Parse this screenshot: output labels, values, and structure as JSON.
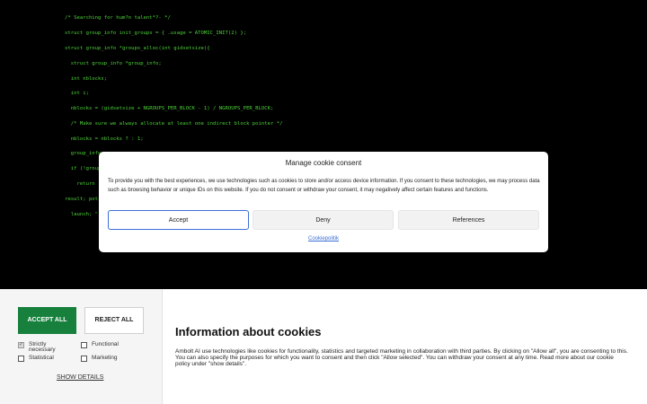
{
  "code": {
    "lines": [
      "/* Searching for hum?n talent*?- */",
      "struct group_info init_groups = { .usage = ATOMIC_INIT(2) };",
      "struct group_info *groups_alloc(int gidsetsize){",
      "  struct group_info *group_info;",
      "  int nblocks;",
      "  int i;",
      "  nblocks = (gidsetsize + NGROUPS_PER_BLOCK - 1) / NGROUPS_PER_BLOCK;",
      "  /* Make sure we always allocate at least one indirect block pointer */",
      "  nblocks = nblocks ? : 1;",
      "  group_info",
      "  if (!group",
      "    return",
      "result; poti",
      "  launch; \""
    ]
  },
  "modal": {
    "title": "Manage cookie consent",
    "text": "To provide you with the best experiences, we use technologies such as cookies to store and/or access device information. If you consent to these technologies, we may process data such as browsing behavior or unique IDs on this website. If you do not consent or withdraw your consent, it may negatively affect certain features and functions.",
    "accept_label": "Accept",
    "deny_label": "Deny",
    "references_label": "References",
    "policy_link": "Cookiepolitik"
  },
  "banner": {
    "accept_all_label": "ACCEPT ALL",
    "reject_all_label": "REJECT ALL",
    "checkboxes": [
      {
        "label": "Strictly necessary",
        "checked": true
      },
      {
        "label": "Functional",
        "checked": false
      },
      {
        "label": "Statistical",
        "checked": false
      },
      {
        "label": "Marketing",
        "checked": false
      }
    ],
    "show_details_label": "SHOW DETAILS",
    "info_title": "Information about cookies",
    "info_text": "Ambolt AI use technologies like cookies for functionality, statistics and targeted marketing in collaboration with third parties. By clicking on \"Allow all\", you are consenting to this. You can also specify the purposes for which you want to consent and then click \"Allow selected\". You can withdraw your consent at any time. Read more about our cookie policy under \"show details\"."
  }
}
